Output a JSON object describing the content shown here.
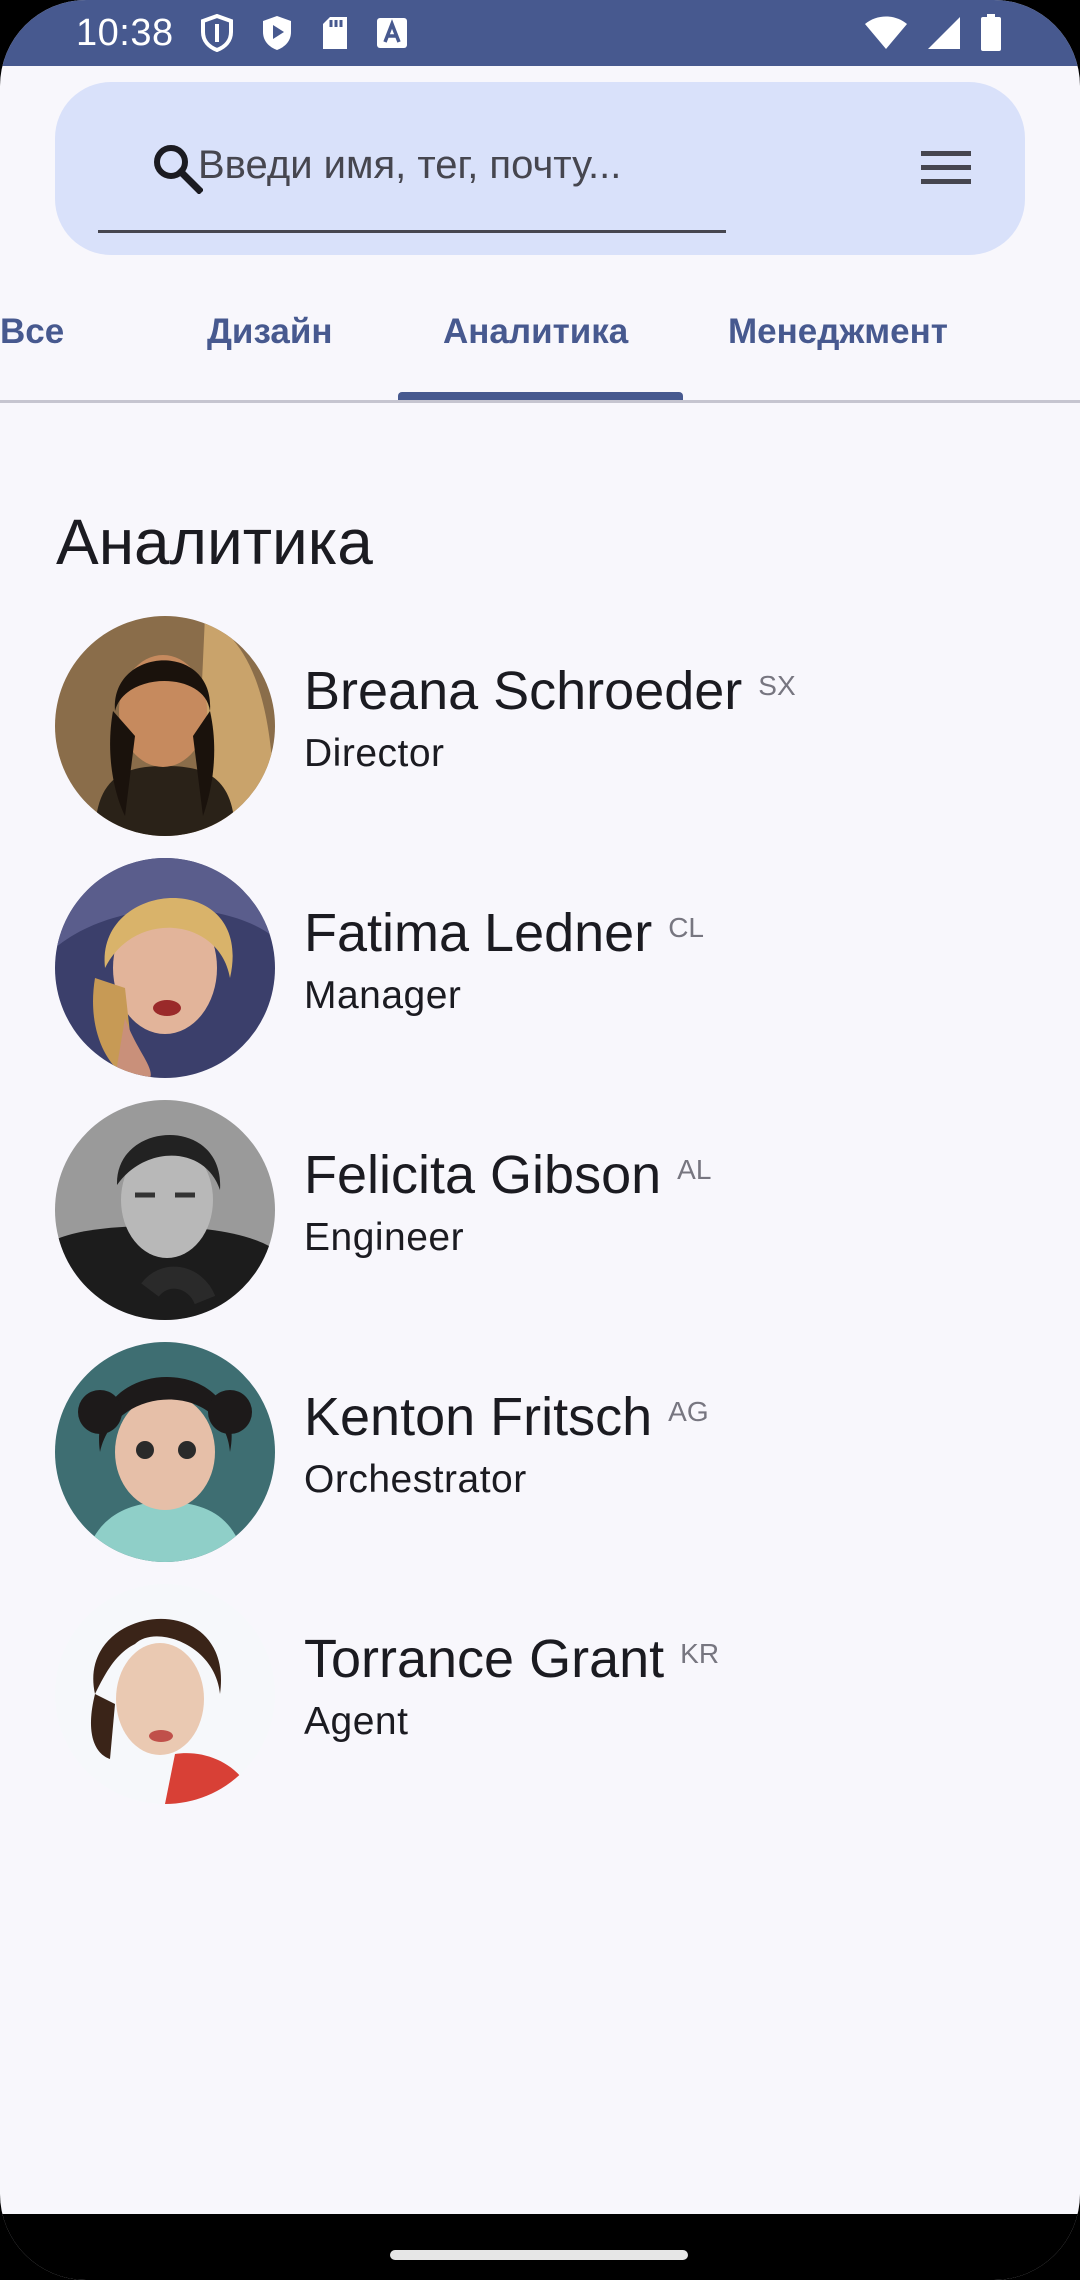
{
  "status_bar": {
    "time": "10:38",
    "left_icons": [
      "shield-icon",
      "play-protect-icon",
      "sd-card-icon",
      "keyboard-a-icon"
    ],
    "right_icons": [
      "wifi-icon",
      "cellular-signal-icon",
      "battery-icon"
    ],
    "color": "#47598f"
  },
  "search": {
    "placeholder": "Введи имя, тег, почту...",
    "value": "",
    "background": "#d9e1fa"
  },
  "tabs": [
    {
      "label": "Все",
      "selected": false
    },
    {
      "label": "Дизайн",
      "selected": false
    },
    {
      "label": "Аналитика",
      "selected": true
    },
    {
      "label": "Менеджмент",
      "selected": false
    }
  ],
  "section": {
    "title": "Аналитика"
  },
  "contacts": [
    {
      "name": "Breana Schroeder",
      "tag": "SX",
      "role": "Director"
    },
    {
      "name": "Fatima Ledner",
      "tag": "CL",
      "role": "Manager"
    },
    {
      "name": "Felicita Gibson",
      "tag": "AL",
      "role": "Engineer"
    },
    {
      "name": "Kenton Fritsch",
      "tag": "AG",
      "role": "Orchestrator"
    },
    {
      "name": "Torrance Grant",
      "tag": "KR",
      "role": "Agent"
    }
  ],
  "colors": {
    "accent": "#47598f",
    "background": "#f8f7fc",
    "text": "#1b1b21",
    "muted": "#777680"
  }
}
